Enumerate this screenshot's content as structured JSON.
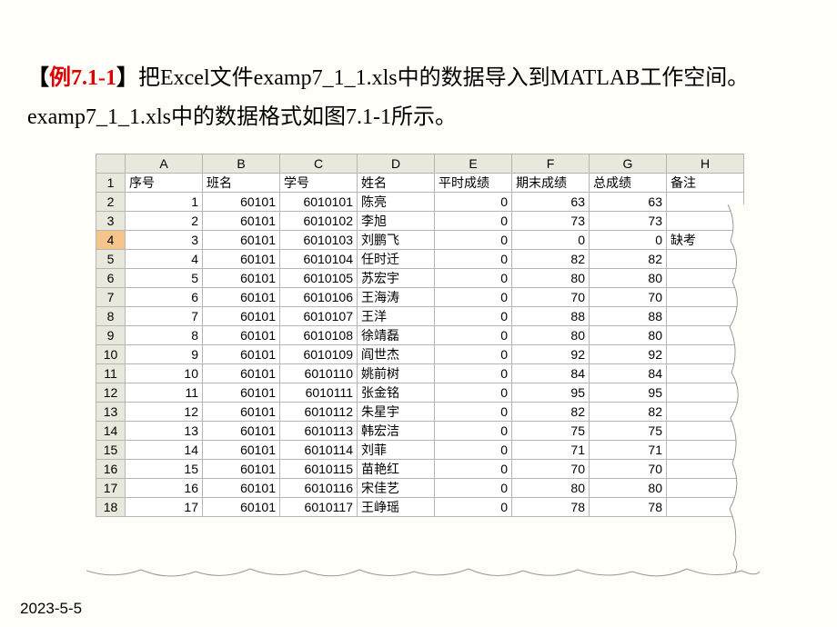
{
  "instruction": {
    "bracket_open": "【",
    "label": "例7.1-1",
    "bracket_close": "】",
    "text": "把Excel文件examp7_1_1.xls中的数据导入到MATLAB工作空间。examp7_1_1.xls中的数据格式如图7.1-1所示。"
  },
  "chart_data": {
    "type": "table",
    "col_letters": [
      "A",
      "B",
      "C",
      "D",
      "E",
      "F",
      "G",
      "H"
    ],
    "headers": [
      "序号",
      "班名",
      "学号",
      "姓名",
      "平时成绩",
      "期末成绩",
      "总成绩",
      "备注"
    ],
    "selected_row": 4,
    "rows": [
      {
        "n": 1,
        "seq": "1",
        "class": "60101",
        "sid": "6010101",
        "name": "陈亮",
        "p": "0",
        "f": "63",
        "t": "63",
        "note": ""
      },
      {
        "n": 2,
        "seq": "2",
        "class": "60101",
        "sid": "6010102",
        "name": "李旭",
        "p": "0",
        "f": "73",
        "t": "73",
        "note": ""
      },
      {
        "n": 3,
        "seq": "3",
        "class": "60101",
        "sid": "6010103",
        "name": "刘鹏飞",
        "p": "0",
        "f": "0",
        "t": "0",
        "note": "缺考"
      },
      {
        "n": 4,
        "seq": "4",
        "class": "60101",
        "sid": "6010104",
        "name": "任时迁",
        "p": "0",
        "f": "82",
        "t": "82",
        "note": ""
      },
      {
        "n": 5,
        "seq": "5",
        "class": "60101",
        "sid": "6010105",
        "name": "苏宏宇",
        "p": "0",
        "f": "80",
        "t": "80",
        "note": ""
      },
      {
        "n": 6,
        "seq": "6",
        "class": "60101",
        "sid": "6010106",
        "name": "王海涛",
        "p": "0",
        "f": "70",
        "t": "70",
        "note": ""
      },
      {
        "n": 7,
        "seq": "7",
        "class": "60101",
        "sid": "6010107",
        "name": "王洋",
        "p": "0",
        "f": "88",
        "t": "88",
        "note": ""
      },
      {
        "n": 8,
        "seq": "8",
        "class": "60101",
        "sid": "6010108",
        "name": "徐靖磊",
        "p": "0",
        "f": "80",
        "t": "80",
        "note": ""
      },
      {
        "n": 9,
        "seq": "9",
        "class": "60101",
        "sid": "6010109",
        "name": "阎世杰",
        "p": "0",
        "f": "92",
        "t": "92",
        "note": ""
      },
      {
        "n": 10,
        "seq": "10",
        "class": "60101",
        "sid": "6010110",
        "name": "姚前树",
        "p": "0",
        "f": "84",
        "t": "84",
        "note": ""
      },
      {
        "n": 11,
        "seq": "11",
        "class": "60101",
        "sid": "6010111",
        "name": "张金铭",
        "p": "0",
        "f": "95",
        "t": "95",
        "note": ""
      },
      {
        "n": 12,
        "seq": "12",
        "class": "60101",
        "sid": "6010112",
        "name": "朱星宇",
        "p": "0",
        "f": "82",
        "t": "82",
        "note": ""
      },
      {
        "n": 13,
        "seq": "13",
        "class": "60101",
        "sid": "6010113",
        "name": "韩宏洁",
        "p": "0",
        "f": "75",
        "t": "75",
        "note": ""
      },
      {
        "n": 14,
        "seq": "14",
        "class": "60101",
        "sid": "6010114",
        "name": "刘菲",
        "p": "0",
        "f": "71",
        "t": "71",
        "note": ""
      },
      {
        "n": 15,
        "seq": "15",
        "class": "60101",
        "sid": "6010115",
        "name": "苗艳红",
        "p": "0",
        "f": "70",
        "t": "70",
        "note": ""
      },
      {
        "n": 16,
        "seq": "16",
        "class": "60101",
        "sid": "6010116",
        "name": "宋佳艺",
        "p": "0",
        "f": "80",
        "t": "80",
        "note": ""
      },
      {
        "n": 17,
        "seq": "17",
        "class": "60101",
        "sid": "6010117",
        "name": "王峥瑶",
        "p": "0",
        "f": "78",
        "t": "78",
        "note": ""
      }
    ]
  },
  "footer_date": "2023-5-5"
}
